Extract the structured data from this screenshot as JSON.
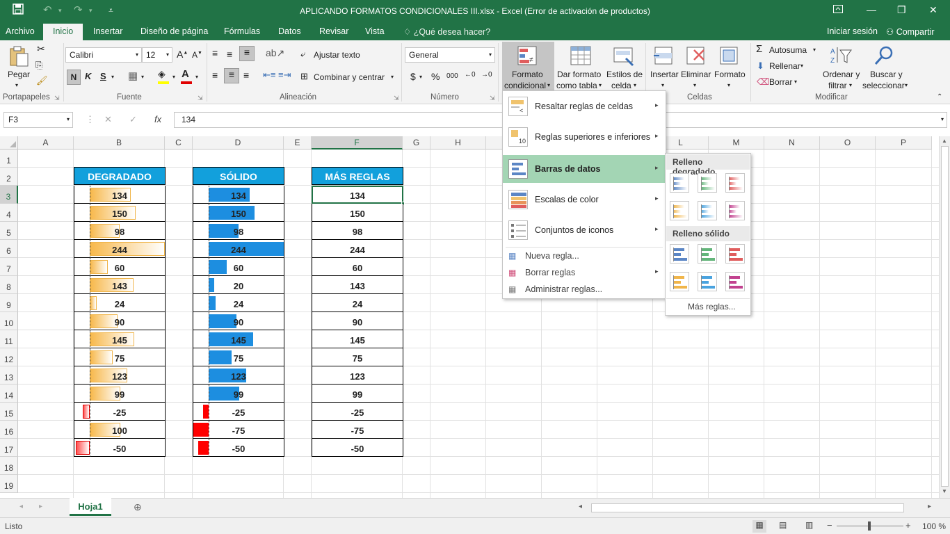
{
  "window": {
    "title": "APLICANDO FORMATOS CONDICIONALES III.xlsx - Excel (Error de activación de productos)"
  },
  "tabs": [
    "Archivo",
    "Inicio",
    "Insertar",
    "Diseño de página",
    "Fórmulas",
    "Datos",
    "Revisar",
    "Vista"
  ],
  "tell_me": "¿Qué desea hacer?",
  "account": {
    "signin": "Iniciar sesión",
    "share": "Compartir"
  },
  "ribbon": {
    "clipboard": {
      "paste": "Pegar",
      "label": "Portapapeles"
    },
    "font": {
      "name": "Calibri",
      "size": "12",
      "bold": "N",
      "italic": "K",
      "underline": "S",
      "label": "Fuente"
    },
    "alignment": {
      "wrap": "Ajustar texto",
      "merge": "Combinar y centrar",
      "label": "Alineación"
    },
    "number": {
      "format": "General",
      "currency": "$",
      "percent": "%",
      "thousands": "000",
      "label": "Número"
    },
    "styles": {
      "cond_format": "Formato condicional",
      "cond_format_1": "Formato",
      "cond_format_2": "condicional",
      "table_1": "Dar formato",
      "table_2": "como tabla",
      "cell_1": "Estilos de",
      "cell_2": "celda"
    },
    "cells": {
      "insert": "Insertar",
      "delete": "Eliminar",
      "format": "Formato",
      "label": "Celdas"
    },
    "editing": {
      "autosum": "Autosuma",
      "fill": "Rellenar",
      "clear": "Borrar",
      "sort_1": "Ordenar y",
      "sort_2": "filtrar",
      "find_1": "Buscar y",
      "find_2": "seleccionar",
      "label": "Modificar"
    }
  },
  "formula_bar": {
    "name_box": "F3",
    "fx": "fx",
    "value": "134"
  },
  "columns": [
    "A",
    "B",
    "C",
    "D",
    "E",
    "F",
    "G",
    "H",
    "I",
    "J",
    "K",
    "L",
    "M",
    "N",
    "O",
    "P"
  ],
  "rows": [
    "1",
    "2",
    "3",
    "4",
    "5",
    "6",
    "7",
    "8",
    "9",
    "10",
    "11",
    "12",
    "13",
    "14",
    "15",
    "16",
    "17",
    "18",
    "19"
  ],
  "tables": {
    "degradado": {
      "header": "DEGRADADO"
    },
    "solido": {
      "header": "SÓLIDO"
    },
    "mas_reglas": {
      "header": "MÁS REGLAS"
    },
    "values": [
      134,
      150,
      98,
      244,
      60,
      143,
      24,
      90,
      145,
      75,
      123,
      99,
      -25,
      100,
      -50
    ],
    "solido_values": [
      134,
      150,
      98,
      244,
      60,
      20,
      24,
      90,
      145,
      75,
      123,
      99,
      -25,
      -75,
      -50
    ],
    "mas_values": [
      134,
      150,
      98,
      244,
      60,
      143,
      24,
      90,
      145,
      75,
      123,
      99,
      -25,
      -75,
      -50
    ]
  },
  "cf_menu": {
    "items": [
      {
        "label": "Resaltar reglas de celdas",
        "key": "R"
      },
      {
        "label": "Reglas superiores e inferiores",
        "key": "R"
      },
      {
        "label": "Barras de datos",
        "key": "d"
      },
      {
        "label": "Escalas de color",
        "key": "E"
      },
      {
        "label": "Conjuntos de iconos",
        "key": "C"
      }
    ],
    "new_rule": "Nueva regla...",
    "clear_rules": "Borrar reglas",
    "manage_rules": "Administrar reglas..."
  },
  "databar_menu": {
    "gradient_header": "Relleno degradado",
    "solid_header": "Relleno sólido",
    "more_rules": "Más reglas...",
    "colors": [
      "#5b86c5",
      "#63b57a",
      "#e05d5d",
      "#f0b54a",
      "#4aa3df",
      "#c2418f"
    ]
  },
  "sheet_tab": "Hoja1",
  "status": {
    "ready": "Listo",
    "zoom": "100 %"
  },
  "colors": {
    "accent": "#217346",
    "header_fill": "#12a0dc",
    "gradient_bar": "#f7b84b",
    "solid_bar": "#1d8ee0",
    "negative": "#ff0000"
  }
}
